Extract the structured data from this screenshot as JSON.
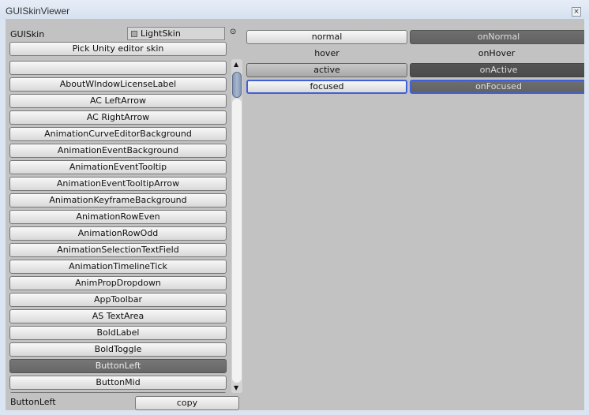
{
  "window": {
    "title": "GUISkinViewer",
    "close_icon": "close-icon"
  },
  "skin": {
    "label": "GUISkin",
    "value": "LightSkin",
    "pick_button": "Pick Unity editor skin"
  },
  "styles": [
    "",
    "AboutWIndowLicenseLabel",
    "AC LeftArrow",
    "AC RightArrow",
    "AnimationCurveEditorBackground",
    "AnimationEventBackground",
    "AnimationEventTooltip",
    "AnimationEventTooltipArrow",
    "AnimationKeyframeBackground",
    "AnimationRowEven",
    "AnimationRowOdd",
    "AnimationSelectionTextField",
    "AnimationTimelineTick",
    "AnimPropDropdown",
    "AppToolbar",
    "AS TextArea",
    "BoldLabel",
    "BoldToggle",
    "ButtonLeft",
    "ButtonMid",
    ""
  ],
  "selected_index": 18,
  "footer": {
    "selected": "ButtonLeft",
    "copy": "copy"
  },
  "states": {
    "normal": "normal",
    "onNormal": "onNormal",
    "hover": "hover",
    "onHover": "onHover",
    "active": "active",
    "onActive": "onActive",
    "focused": "focused",
    "onFocused": "onFocused"
  }
}
